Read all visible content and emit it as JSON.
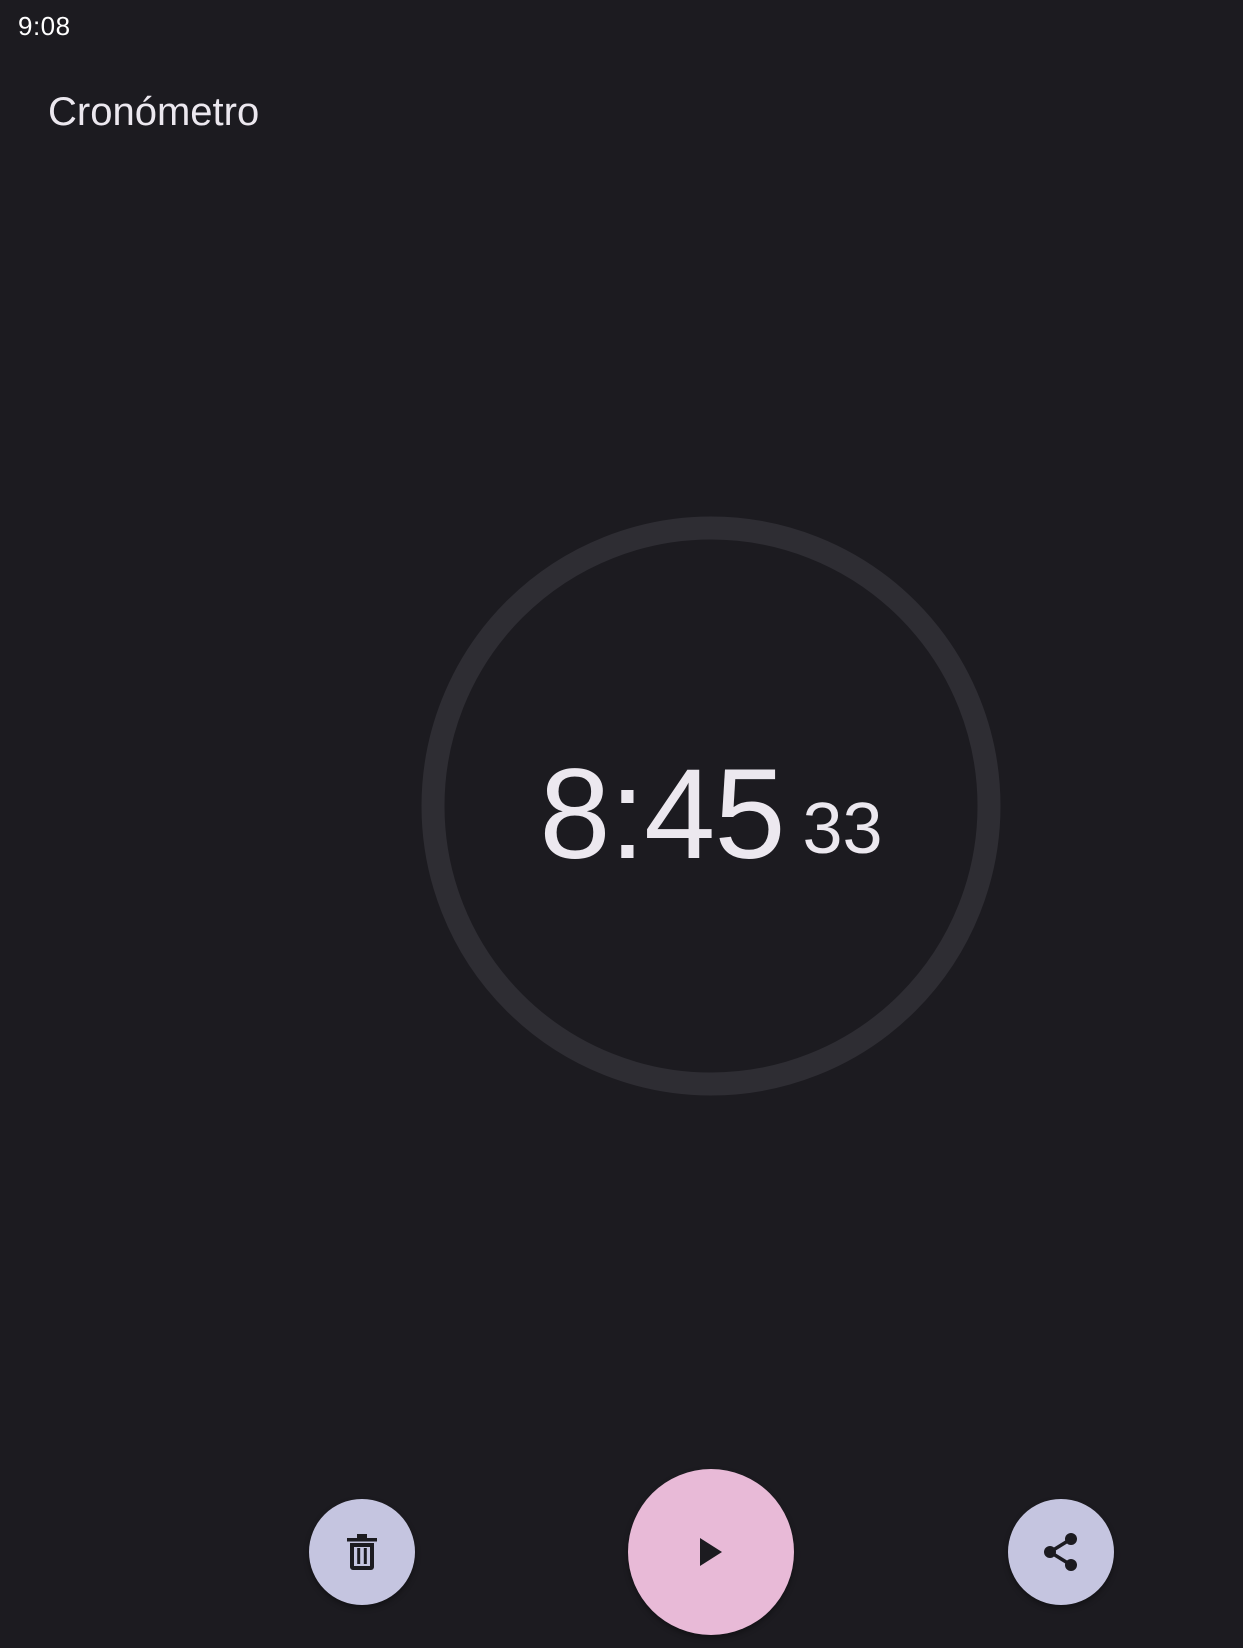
{
  "status_bar": {
    "time": "9:08"
  },
  "app_bar": {
    "title": "Cronómetro"
  },
  "stopwatch": {
    "main": "8:45",
    "hundredths": "33"
  },
  "controls": {
    "reset_icon": "trash-icon",
    "start_icon": "play-icon",
    "share_icon": "share-icon"
  },
  "colors": {
    "background": "#1c1b20",
    "dial_ring": "#2e2d33",
    "text": "#ece8ef",
    "secondary_button": "#c5c5e0",
    "primary_button": "#e8bad7",
    "icon": "#1c1b20"
  }
}
